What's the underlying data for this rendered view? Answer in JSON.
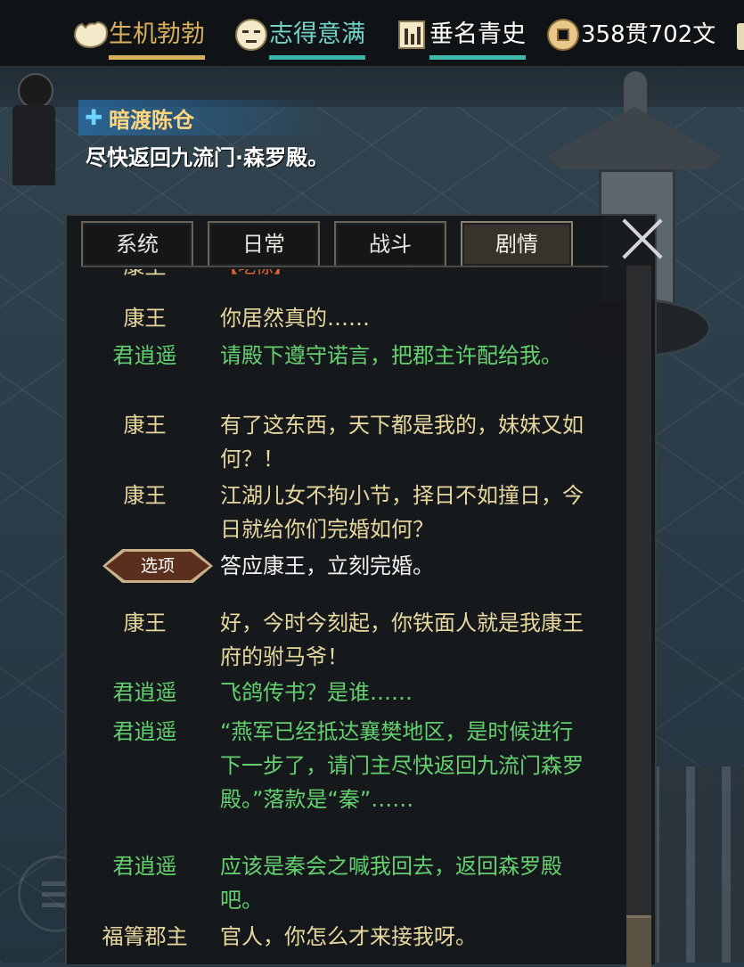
{
  "status": {
    "vitality": {
      "label": "生机勃勃",
      "icon": "muscle-arm-icon",
      "bar_color": "#d8b25a"
    },
    "mood": {
      "label": "志得意满",
      "icon": "calm-face-icon",
      "bar_color": "#38b5a8"
    },
    "fame": {
      "label": "垂名青史",
      "icon": "fame-stele-icon",
      "bar_color": "#3fb8ad"
    },
    "money": {
      "label": "358贯702文",
      "icon": "copper-coin-icon"
    }
  },
  "quest": {
    "title": "暗渡陈仓",
    "description": "尽快返回九流门·森罗殿。"
  },
  "tabs": [
    {
      "label": "系统",
      "active": false
    },
    {
      "label": "日常",
      "active": false
    },
    {
      "label": "战斗",
      "active": false
    },
    {
      "label": "剧情",
      "active": true
    }
  ],
  "log": [
    {
      "speaker": "康王",
      "text": "【吃惊】"
    },
    {
      "speaker": "康王",
      "text": "你居然真的……"
    },
    {
      "speaker": "君逍遥",
      "text": "请殿下遵守诺言，把郡主许配给我。"
    },
    {
      "speaker": "康王",
      "text": "有了这东西，天下都是我的，妹妹又如何？！"
    },
    {
      "speaker": "康王",
      "text": "江湖儿女不拘小节，择日不如撞日，今日就给你们完婚如何？"
    },
    {
      "speaker": "选项",
      "text": "答应康王，立刻完婚。",
      "is_option": true
    },
    {
      "speaker": "康王",
      "text": "好，今时今刻起，你铁面人就是我康王府的驸马爷！"
    },
    {
      "speaker": "君逍遥",
      "text": "飞鸽传书？是谁……"
    },
    {
      "speaker": "君逍遥",
      "text": "“燕军已经抵达襄樊地区，是时候进行下一步了，请门主尽快返回九流门森罗殿。”落款是“秦”……"
    },
    {
      "speaker": "君逍遥",
      "text": "应该是秦会之喊我回去，返回森罗殿吧。"
    },
    {
      "speaker": "福箐郡主",
      "text": "官人，你怎么才来接我呀。"
    }
  ]
}
